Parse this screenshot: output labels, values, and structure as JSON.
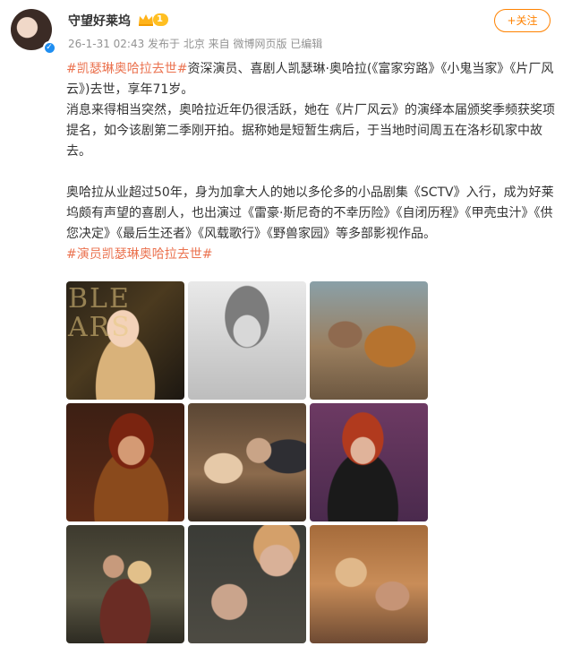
{
  "post": {
    "username": "守望好莱坞",
    "level": "1",
    "meta": "26-1-31 02:43 发布于 北京  来自 微博网页版 已编辑",
    "follow_label": "+关注"
  },
  "content": {
    "tag_start": "#凯瑟琳奥哈拉去世#",
    "line1_rest": "资深演员、喜剧人凯瑟琳·奥哈拉(《富家穷路》《小鬼当家》《片厂风云》)去世，享年71岁。",
    "para2": "消息来得相当突然，奥哈拉近年仍很活跃，她在《片厂风云》的演绎本届颁奖季频获奖项提名，如今该剧第二季刚开拍。据称她是短暂生病后，于当地时间周五在洛杉矶家中故去。",
    "para3": "奥哈拉从业超过50年，身为加拿大人的她以多伦多的小品剧集《SCTV》入行，成为好莱坞颇有声望的喜剧人，也出演过《雷豪·斯尼奇的不幸历险》《自闭历程》《甲壳虫汁》《供您决定》《最后生还者》《风载歌行》《野兽家园》等多部影视作品。",
    "tag_end": "#演员凯瑟琳奥哈拉去世#"
  },
  "photos": [
    {
      "name": "photo-1",
      "overlay": "BLE ARS"
    },
    {
      "name": "photo-2",
      "overlay": ""
    },
    {
      "name": "photo-3",
      "overlay": ""
    },
    {
      "name": "photo-4",
      "overlay": ""
    },
    {
      "name": "photo-5",
      "overlay": ""
    },
    {
      "name": "photo-6",
      "overlay": ""
    },
    {
      "name": "photo-7",
      "overlay": ""
    },
    {
      "name": "photo-8",
      "overlay": ""
    },
    {
      "name": "photo-9",
      "overlay": ""
    }
  ],
  "colors": {
    "accent": "#ff8200",
    "tag": "#eb7350",
    "verified": "#1f8ef1",
    "level_badge": "#ffbf22"
  },
  "icons": {
    "verified": "verified-check-icon",
    "crown": "crown-icon"
  }
}
